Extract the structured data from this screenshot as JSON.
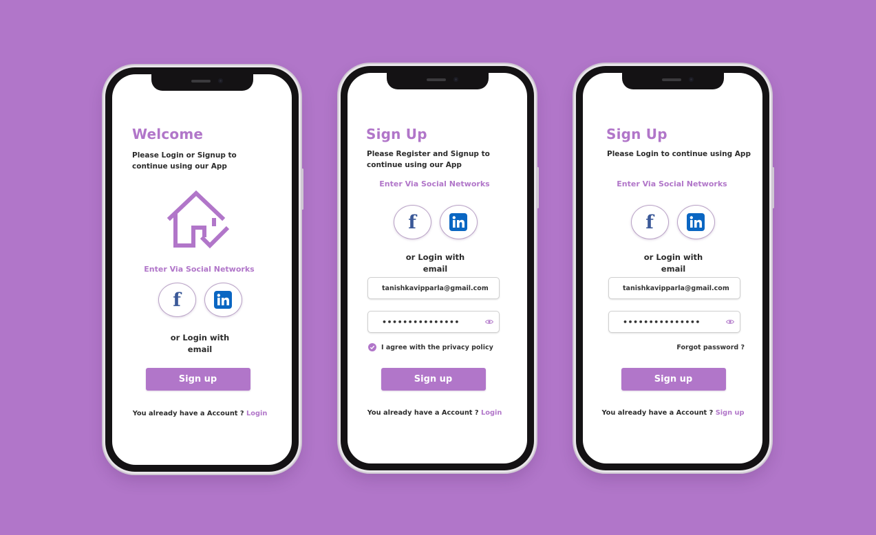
{
  "colors": {
    "background": "#b176c9",
    "accent": "#b176c9",
    "text": "#2b2b2b",
    "facebook": "#3b5998",
    "linkedin": "#0a66c2"
  },
  "screens": [
    {
      "title": "Welcome",
      "subtitle": "Please Login or Signup  to continue using our App",
      "illustration": "house-check-icon",
      "social_label": "Enter Via Social Networks",
      "social_buttons": [
        {
          "icon": "facebook-icon",
          "glyph": "f"
        },
        {
          "icon": "linkedin-icon",
          "glyph": "in"
        }
      ],
      "or_login": [
        "or Login with",
        "email"
      ],
      "button_label": "Sign up",
      "account_text": "You already have a Account ? ",
      "account_link": "Login"
    },
    {
      "title": "Sign Up",
      "subtitle": "Please Register and Signup  to continue using our App",
      "social_label": "Enter Via Social Networks",
      "social_buttons": [
        {
          "icon": "facebook-icon",
          "glyph": "f"
        },
        {
          "icon": "linkedin-icon",
          "glyph": "in"
        }
      ],
      "or_login": [
        "or Login with",
        "email"
      ],
      "email_value": "tanishkavipparla@gmail.com",
      "password_value": "•••••••••••••••",
      "agree_label": "I agree with the privacy policy",
      "agree_checked": true,
      "button_label": "Sign up",
      "account_text": "You already have a Account ? ",
      "account_link": "Login"
    },
    {
      "title": "Sign Up",
      "subtitle": "Please Login  to continue using App",
      "social_label": "Enter Via Social Networks",
      "social_buttons": [
        {
          "icon": "facebook-icon",
          "glyph": "f"
        },
        {
          "icon": "linkedin-icon",
          "glyph": "in"
        }
      ],
      "or_login": [
        "or Login with",
        "email"
      ],
      "email_value": "tanishkavipparla@gmail.com",
      "password_value": "•••••••••••••••",
      "forgot_label": "Forgot password ?",
      "button_label": "Sign up",
      "account_text": "You already have a Account ? ",
      "account_link": "Sign up"
    }
  ]
}
